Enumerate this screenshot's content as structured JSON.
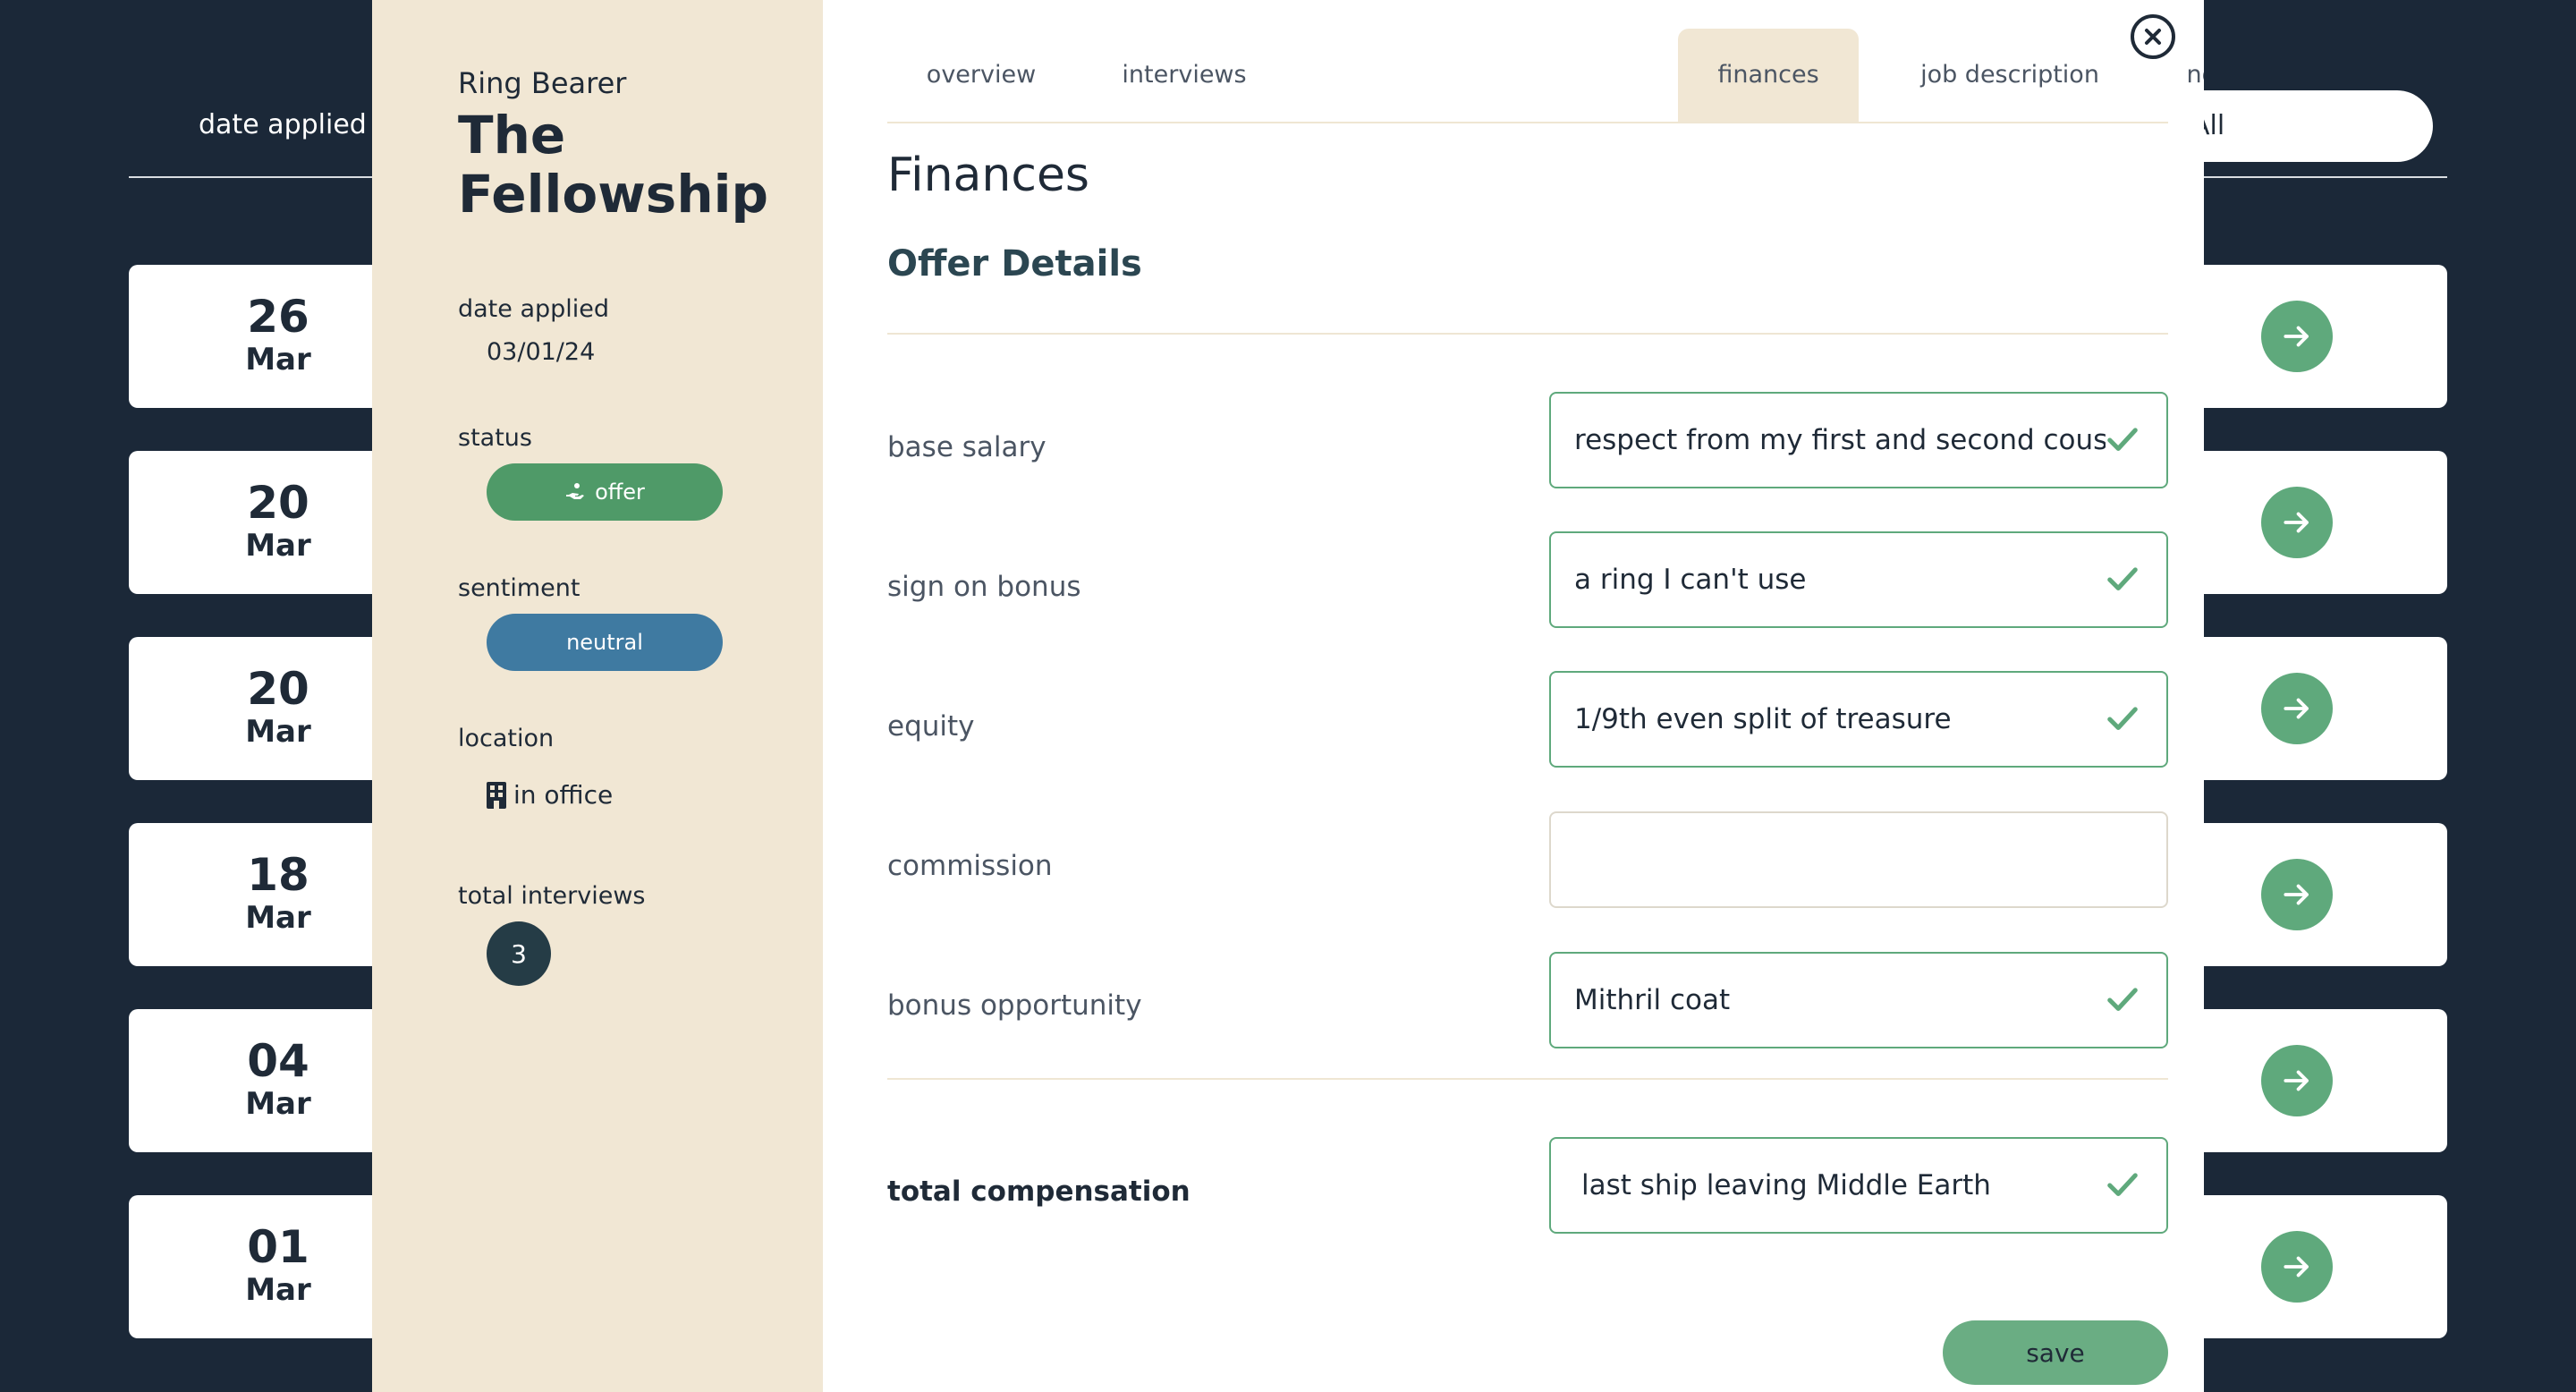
{
  "background": {
    "header_label": "date applied",
    "filter_value": "All",
    "rows": [
      {
        "day": "26",
        "month": "Mar"
      },
      {
        "day": "20",
        "month": "Mar"
      },
      {
        "day": "20",
        "month": "Mar"
      },
      {
        "day": "18",
        "month": "Mar"
      },
      {
        "day": "04",
        "month": "Mar"
      },
      {
        "day": "01",
        "month": "Mar"
      }
    ],
    "row_action_icon": "arrow-right-icon"
  },
  "sidebar": {
    "role": "Ring Bearer",
    "company": "The Fellowship",
    "date_applied_label": "date applied",
    "date_applied": "03/01/24",
    "status_label": "status",
    "status": "offer",
    "status_icon": "hand-coin-icon",
    "status_color": "#4f9a68",
    "sentiment_label": "sentiment",
    "sentiment": "neutral",
    "sentiment_color": "#3f7aa1",
    "location_label": "location",
    "location": "in office",
    "location_icon": "building-icon",
    "interviews_label": "total interviews",
    "interviews_count": "3"
  },
  "tabs": [
    {
      "label": "overview",
      "active": false
    },
    {
      "label": "interviews",
      "active": false
    },
    {
      "label": "finances",
      "active": true
    },
    {
      "label": "job description",
      "active": false
    },
    {
      "label": "notes",
      "active": false
    }
  ],
  "close_icon": "close-circle-icon",
  "main": {
    "title": "Finances",
    "section_title": "Offer Details",
    "fields": [
      {
        "label": "base salary",
        "value": "respect from my first and second cousin",
        "valid": true
      },
      {
        "label": "sign on bonus",
        "value": "a ring I can't use",
        "valid": true
      },
      {
        "label": "equity",
        "value": "1/9th even split of treasure",
        "valid": true
      },
      {
        "label": "commission",
        "value": "",
        "valid": false
      },
      {
        "label": "bonus opportunity",
        "value": "Mithril coat",
        "valid": true
      }
    ],
    "total": {
      "label": "total compensation",
      "value": "last ship leaving Middle Earth",
      "valid": true
    },
    "save_label": "save"
  },
  "colors": {
    "background": "#1b2838",
    "sidebar": "#f1e7d4",
    "accent_green": "#5fa97c",
    "heading": "#2b4651"
  }
}
